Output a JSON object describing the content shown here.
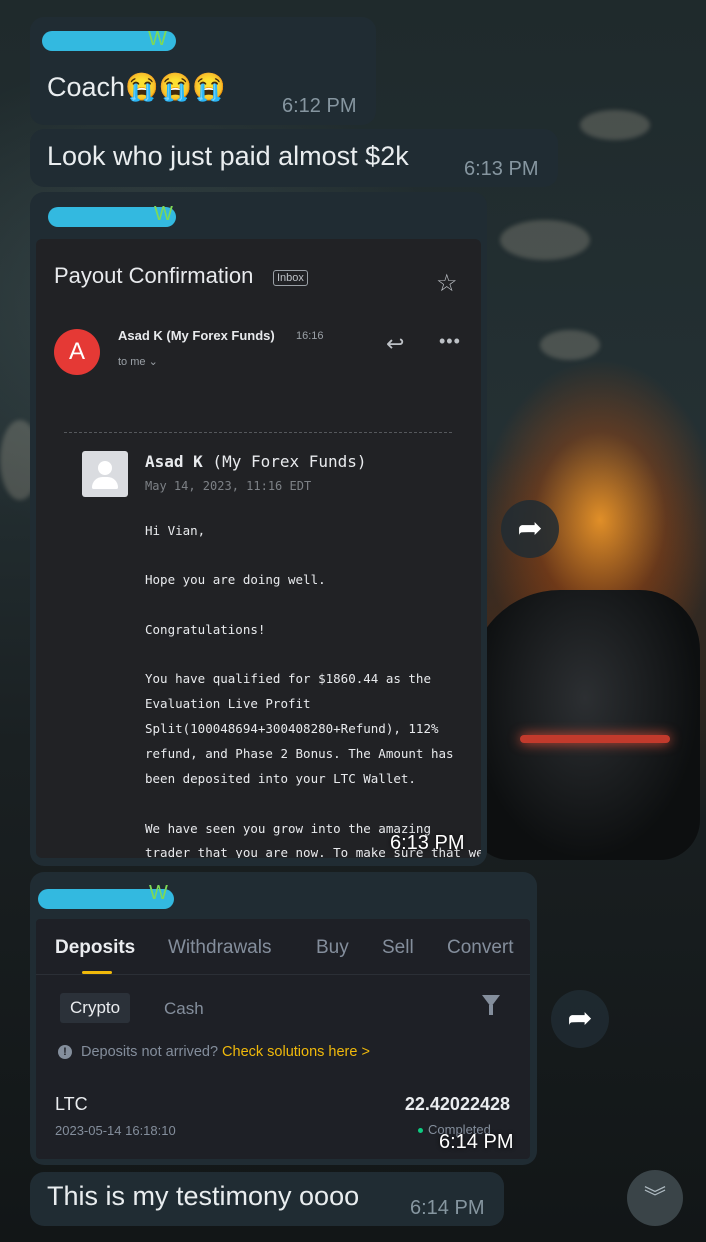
{
  "messages": [
    {
      "sender_suffix": "W",
      "text": "Coach😭😭😭",
      "time": "6:12 PM"
    },
    {
      "text": "Look who just paid almost $2k",
      "time": "6:13 PM"
    },
    {
      "sender_suffix": "W",
      "time": "6:13 PM",
      "email": {
        "subject": "Payout Confirmation",
        "tag": "Inbox",
        "sender_initial": "A",
        "sender": "Asad K (My Forex Funds)",
        "sender_time": "16:16",
        "to": "to me ⌄",
        "quoted_sender_bold": "Asad K",
        "quoted_sender_rest": " (My Forex Funds)",
        "quoted_date": "May 14, 2023, 11:16 EDT",
        "body_lines": [
          "Hi Vian,",
          "Hope you are doing well.",
          "Congratulations!",
          "You have qualified for $1860.44 as the",
          "Evaluation Live Profit",
          "Split(100048694+300408280+Refund), 112%",
          "refund, and Phase 2 Bonus. The Amount has",
          "been deposited into your LTC Wallet.",
          "We have seen you grow into the amazing",
          "trader that you are now. To make sure that we"
        ]
      }
    },
    {
      "sender_suffix": "W",
      "time": "6:14 PM",
      "deposits": {
        "tabs": [
          "Deposits",
          "Withdrawals",
          "Buy",
          "Sell",
          "Convert"
        ],
        "filter_crypto": "Crypto",
        "filter_cash": "Cash",
        "info_text": "Deposits not arrived? ",
        "info_link": "Check solutions here >",
        "coin": "LTC",
        "amount": "22.42022428",
        "date": "2023-05-14 16:18:10",
        "status": "Completed"
      }
    },
    {
      "text": "This is my testimony oooo",
      "time": "6:14 PM"
    }
  ],
  "icons": {
    "forward": "forward-icon",
    "scroll": "double-chevron-down-icon"
  },
  "colors": {
    "bubble": "#202c33",
    "sender_name": "#7ed957",
    "redaction": "#33b9e0",
    "binance_yellow": "#f0b90b"
  }
}
